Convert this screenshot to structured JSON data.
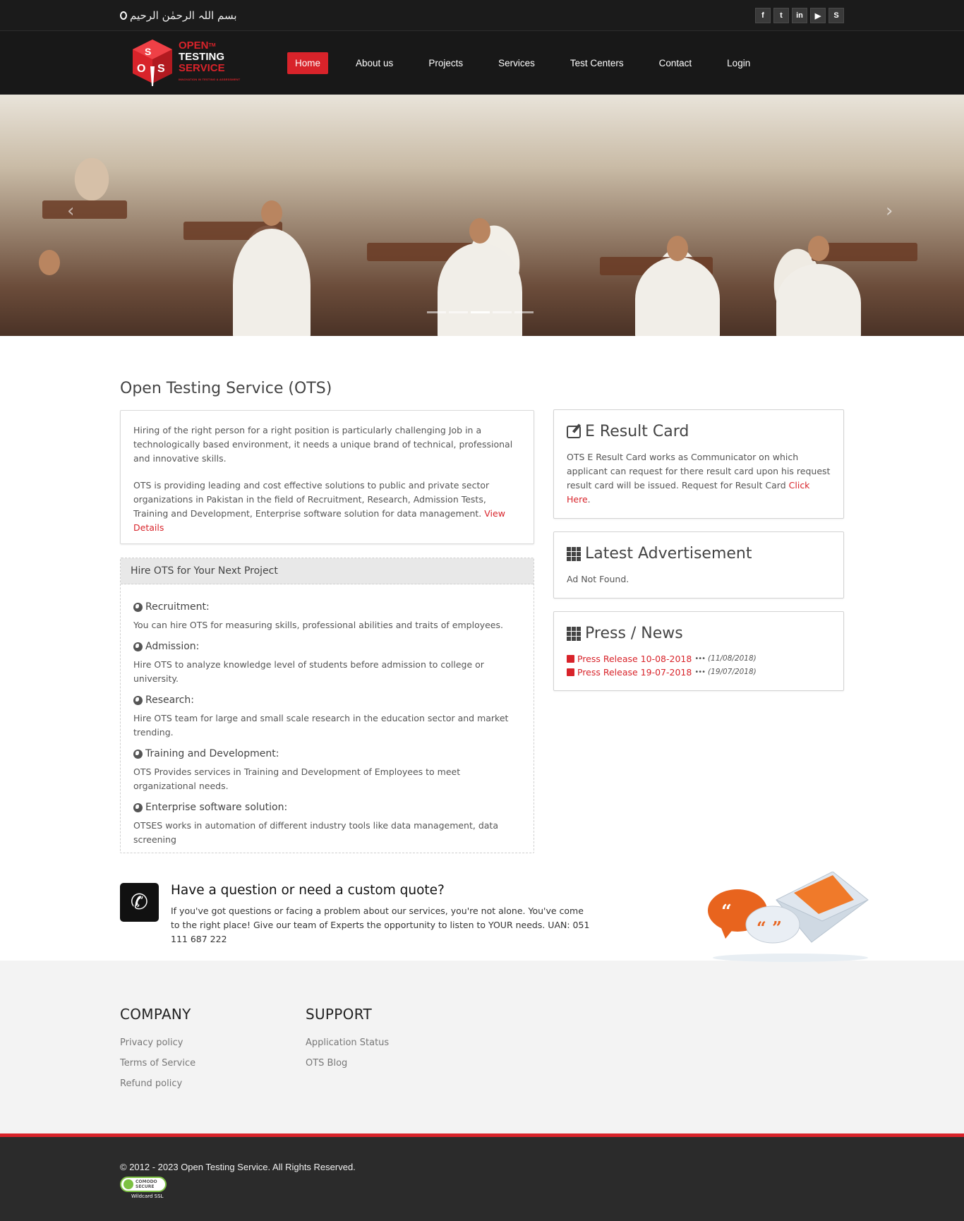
{
  "topbar": {
    "bismillah": "بسم اللہ الرحمٰن الرحیم",
    "social": [
      {
        "icon": "facebook-icon",
        "glyph": "f"
      },
      {
        "icon": "twitter-icon",
        "glyph": "t"
      },
      {
        "icon": "linkedin-icon",
        "glyph": "in"
      },
      {
        "icon": "youtube-icon",
        "glyph": "▶"
      },
      {
        "icon": "skype-icon",
        "glyph": "S"
      }
    ]
  },
  "logo": {
    "open": "OPEN",
    "tm": "TM",
    "testing": "TESTING",
    "service": "SERVICE",
    "tagline": "INNOVATION IN TESTING & ASSESSMENT"
  },
  "nav": {
    "items": [
      "Home",
      "About us",
      "Projects",
      "Services",
      "Test Centers",
      "Contact",
      "Login"
    ],
    "active": "Home"
  },
  "slider": {
    "slide_count": 5,
    "active_slide": 3
  },
  "main": {
    "title": "Open Testing Service (OTS)",
    "intro_p1": "Hiring of the right person for a right position is particularly challenging Job in a technologically based environment, it needs a unique brand of technical, professional and innovative skills.",
    "intro_p2": "OTS is providing leading and cost effective solutions to public and private sector organizations in Pakistan in the field of Recruitment, Research, Admission Tests, Training and Development, Enterprise software solution for data management.",
    "view_details": "View Details",
    "hire": {
      "heading": "Hire OTS for Your Next Project",
      "items": [
        {
          "title": "Recruitment:",
          "text": "You can hire OTS for measuring skills, professional abilities and traits of employees."
        },
        {
          "title": "Admission:",
          "text": "Hire OTS to analyze knowledge level of students before admission to college or university."
        },
        {
          "title": "Research:",
          "text": "Hire OTS team for large and small scale research in the education sector and market trending."
        },
        {
          "title": "Training and Development:",
          "text": "OTS Provides services in Training and Development of Employees to meet organizational needs."
        },
        {
          "title": "Enterprise software solution:",
          "text": "OTSES works in automation of different industry tools like data management, data screening"
        }
      ]
    }
  },
  "sidebar": {
    "result_card": {
      "title": "E Result Card",
      "text": "OTS E Result Card works as Communicator on which applicant can request for there result card upon his request result card will be issued. Request for Result Card",
      "link": "Click Here",
      "after": "."
    },
    "advertisement": {
      "title": "Latest Advertisement",
      "text": "Ad Not Found."
    },
    "news": {
      "title": "Press / News",
      "items": [
        {
          "label": "Press Release 10-08-2018",
          "date": "(11/08/2018)"
        },
        {
          "label": "Press Release 19-07-2018",
          "date": "(19/07/2018)"
        }
      ]
    }
  },
  "cta": {
    "title": "Have a question or need a custom quote?",
    "text": "If you've got questions or facing a problem about our services, you're not alone. You've come to the right place! Give our team of Experts the opportunity to listen to YOUR needs. UAN: 051 111 687 222"
  },
  "footer": {
    "company": {
      "title": "COMPANY",
      "links": [
        "Privacy policy",
        "Terms of Service",
        "Refund policy"
      ]
    },
    "support": {
      "title": "SUPPORT",
      "links": [
        "Application Status",
        "OTS Blog"
      ]
    },
    "copyright": "© 2012 - 2023 Open Testing Service. All Rights Reserved.",
    "ssl_badge": {
      "line1": "COMODO",
      "line2": "SECURE",
      "sub": "Wildcard SSL"
    }
  },
  "colors": {
    "brand_red": "#d8232a",
    "dark": "#181818",
    "footer_bg": "#f3f3f3"
  }
}
